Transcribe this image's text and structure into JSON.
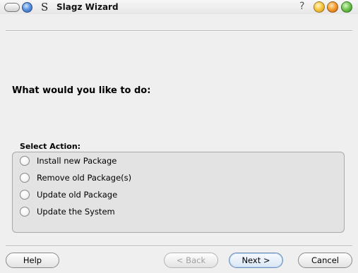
{
  "window": {
    "title": "Slagz Wizard",
    "app_icon_glyph": "S",
    "help_glyph": "?"
  },
  "main": {
    "question": "What would you like to do:",
    "group_label": "Select Action:",
    "options": [
      {
        "label": "Install new Package",
        "selected": false
      },
      {
        "label": "Remove old Package(s)",
        "selected": false
      },
      {
        "label": "Update old Package",
        "selected": false
      },
      {
        "label": "Update the System",
        "selected": false
      }
    ]
  },
  "buttons": {
    "help": "Help",
    "back": "< Back",
    "next": "Next >",
    "cancel": "Cancel"
  }
}
